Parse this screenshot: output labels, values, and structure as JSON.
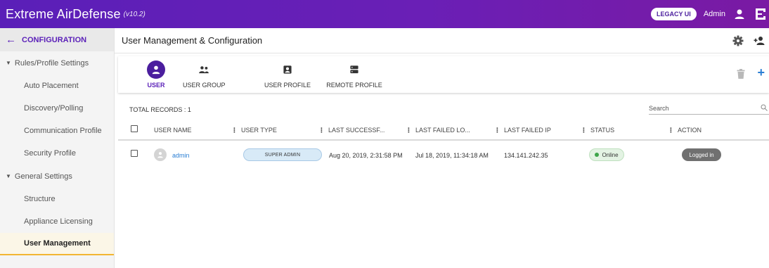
{
  "app": {
    "title": "Extreme AirDefense",
    "version": "(v10.2)"
  },
  "topbar": {
    "legacy_label": "LEGACY UI",
    "user_label": "Admin"
  },
  "sidebar": {
    "header": "CONFIGURATION",
    "sections": [
      {
        "label": "Rules/Profile Settings",
        "items": [
          "Auto Placement",
          "Discovery/Polling",
          "Communication Profile",
          "Security Profile"
        ]
      },
      {
        "label": "General Settings",
        "items": [
          "Structure",
          "Appliance Licensing",
          "User Management"
        ]
      }
    ],
    "active_item": "User Management"
  },
  "main": {
    "title": "User Management & Configuration"
  },
  "tabs": [
    {
      "label": "USER",
      "icon": "user-icon",
      "active": true
    },
    {
      "label": "USER GROUP",
      "icon": "user-group-icon",
      "active": false
    },
    {
      "label": "USER PROFILE",
      "icon": "user-profile-icon",
      "active": false
    },
    {
      "label": "REMOTE PROFILE",
      "icon": "remote-profile-icon",
      "active": false
    }
  ],
  "table": {
    "total_records": "TOTAL RECORDS : 1",
    "search_placeholder": "Search",
    "columns": [
      "USER NAME",
      "USER TYPE",
      "LAST SUCCESSF...",
      "LAST FAILED LO...",
      "LAST FAILED IP",
      "STATUS",
      "ACTION"
    ],
    "rows": [
      {
        "user_name": "admin",
        "user_type": "SUPER ADMIN",
        "last_success": "Aug 20, 2019, 2:31:58 PM",
        "last_failed_login": "Jul 18, 2019, 11:34:18 AM",
        "last_failed_ip": "134.141.242.35",
        "status": "Online",
        "action": "Logged in"
      }
    ]
  },
  "colors": {
    "brand": "#5a1fb8",
    "accent_link": "#2b7fd4",
    "active_underline": "#f2b632",
    "online": "#3ea54a"
  }
}
